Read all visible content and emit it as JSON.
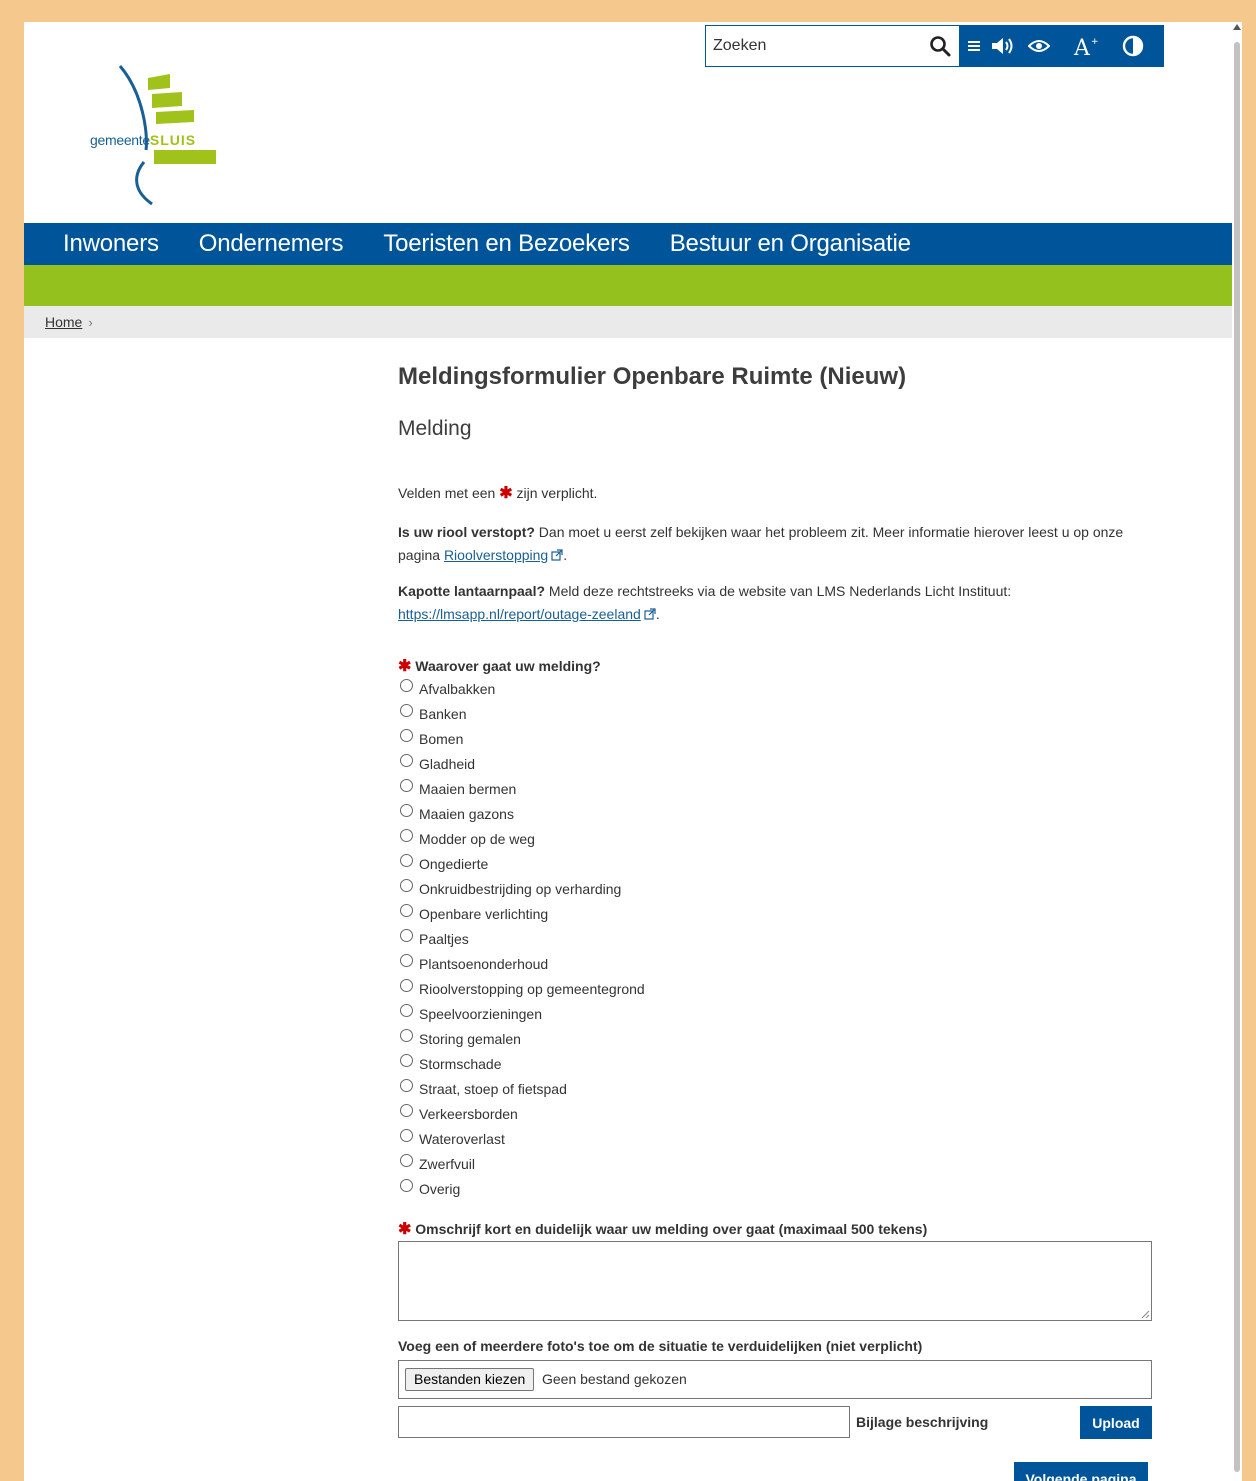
{
  "header": {
    "logo": {
      "prefix": "gemeente",
      "name": "SLUIS"
    },
    "search": {
      "placeholder": "Zoeken"
    },
    "toolbar_icons": [
      "menu-icon",
      "speaker-icon",
      "eye-icon",
      "text-size-icon",
      "contrast-icon"
    ]
  },
  "nav": {
    "items": [
      "Inwoners",
      "Ondernemers",
      "Toeristen en Bezoekers",
      "Bestuur en Organisatie"
    ]
  },
  "breadcrumb": {
    "home": "Home",
    "separator": "›"
  },
  "form": {
    "title": "Meldingsformulier Openbare Ruimte (Nieuw)",
    "section": "Melding",
    "required_note_pre": "Velden met een",
    "required_mark": "✱",
    "required_note_post": "zijn verplicht.",
    "riool": {
      "bold": "Is uw riool verstopt?",
      "text": "Dan moet u eerst zelf bekijken waar het probleem zit. Meer informatie hierover leest u op onze pagina",
      "link": "Rioolverstopping",
      "end": "."
    },
    "lantaarn": {
      "bold": "Kapotte lantaarnpaal?",
      "text": "Meld deze rechtstreeks via de website van LMS Nederlands Licht Instituut:",
      "link": "https://lmsapp.nl/report/outage-zeeland",
      "end": "."
    },
    "question": "Waarover gaat uw melding?",
    "options": [
      "Afvalbakken",
      "Banken",
      "Bomen",
      "Gladheid",
      "Maaien bermen",
      "Maaien gazons",
      "Modder op de weg",
      "Ongedierte",
      "Onkruidbestrijding op verharding",
      "Openbare verlichting",
      "Paaltjes",
      "Plantsoenonderhoud",
      "Rioolverstopping op gemeentegrond",
      "Speelvoorzieningen",
      "Storing gemalen",
      "Stormschade",
      "Straat, stoep of fietspad",
      "Verkeersborden",
      "Wateroverlast",
      "Zwerfvuil",
      "Overig"
    ],
    "description_label": "Omschrijf kort en duidelijk waar uw melding over gaat (maximaal 500 tekens)",
    "photos_label": "Voeg een of meerdere foto's toe om de situatie te verduidelijken (niet verplicht)",
    "file_button": "Bestanden kiezen",
    "file_status": "Geen bestand gekozen",
    "attachment_label": "Bijlage beschrijving",
    "upload": "Upload",
    "next": "Volgende pagina"
  },
  "colors": {
    "brand_blue": "#00559a",
    "brand_green": "#95c11f",
    "required": "#cc0000"
  }
}
